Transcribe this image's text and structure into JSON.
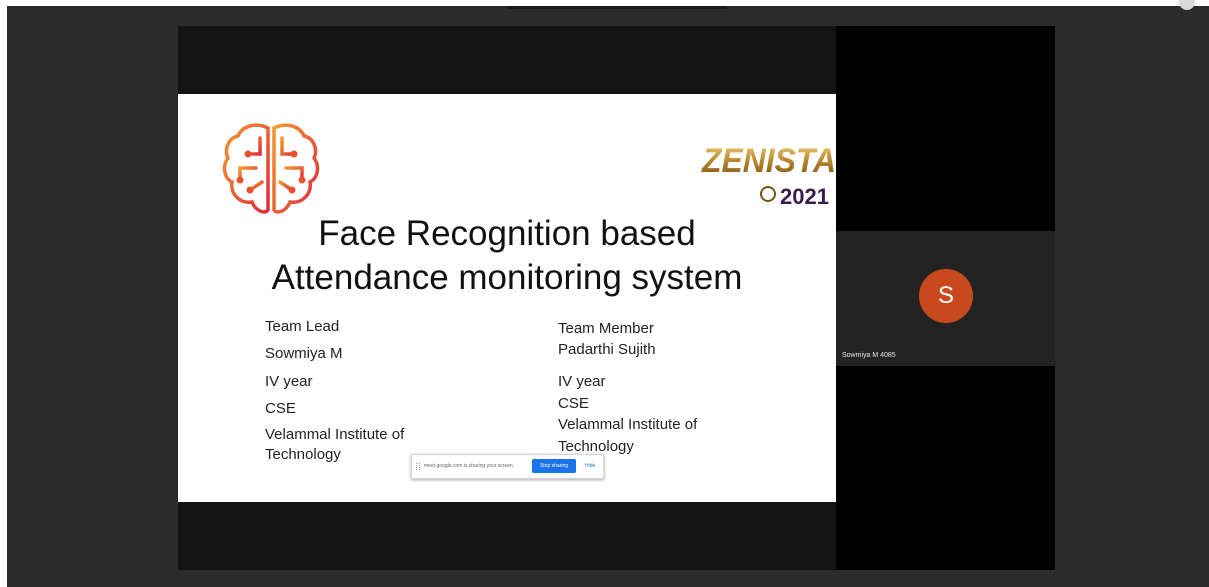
{
  "slide": {
    "title_line1": "Face Recognition based",
    "title_line2": "Attendance monitoring system",
    "left_column": [
      "Team Lead",
      "Sowmiya M",
      "IV year",
      "CSE",
      "Velammal Institute of",
      "Technology"
    ],
    "right_column": [
      "Team Member",
      "Padarthi Sujith",
      "IV year",
      "CSE",
      "Velammal Institute of",
      "Technology"
    ],
    "logo_right_text": "ZENISTA",
    "logo_right_year": "2021",
    "logo_left": "brain-circuit-logo"
  },
  "share_banner": {
    "message": "meet.google.com is sharing your screen.",
    "stop_label": "Stop sharing",
    "hide_label": "Hide"
  },
  "participant": {
    "avatar_letter": "S",
    "name": "Sowmiya M 4085",
    "avatar_color": "#c8491b"
  },
  "colors": {
    "background": "#2b2b2b",
    "accent": "#1a73e8"
  }
}
